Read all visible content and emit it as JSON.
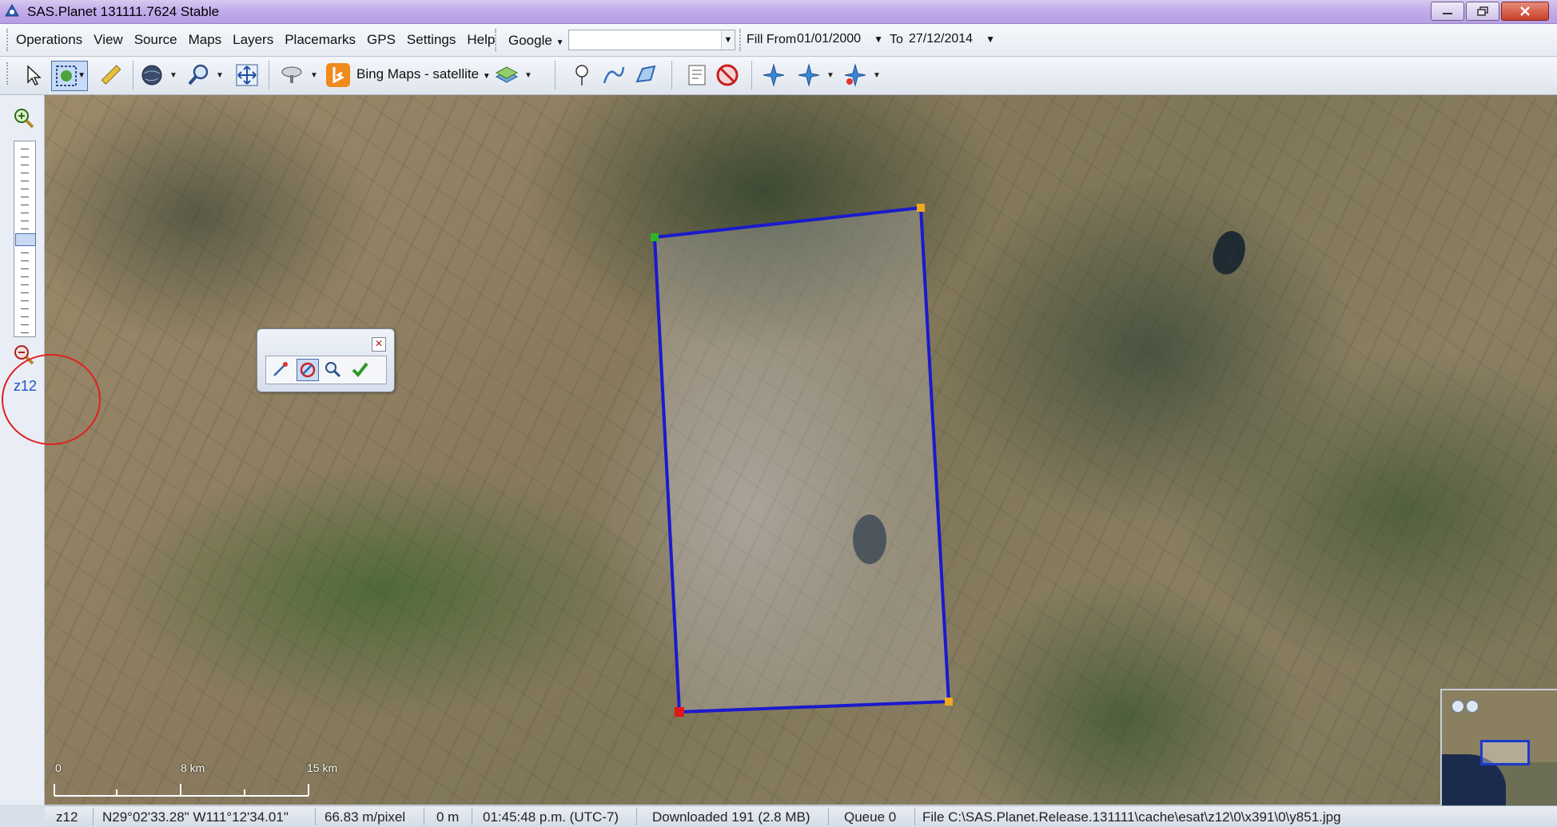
{
  "window": {
    "title": "SAS.Planet 131111.7624 Stable"
  },
  "menu": {
    "items": [
      "Operations",
      "View",
      "Source",
      "Maps",
      "Layers",
      "Placemarks",
      "GPS",
      "Settings",
      "Help"
    ],
    "google_label": "Google",
    "search_placeholder": ""
  },
  "fill": {
    "from_label": "Fill From",
    "from_date": "01/01/2000",
    "to_label": "To",
    "to_date": "27/12/2014"
  },
  "toolbar": {
    "map_source": "Bing Maps - satellite"
  },
  "left_panel": {
    "zoom_label": "z12"
  },
  "scale_bar": {
    "ticks": [
      "0",
      "8 km",
      "15 km"
    ]
  },
  "status": {
    "zoom": "z12",
    "coordinates": "N29°02'33.28\" W111°12'34.01\"",
    "resolution": "66.83 m/pixel",
    "altitude": "0 m",
    "time": "01:45:48 p.m. (UTC-7)",
    "downloaded": "Downloaded 191 (2.8 MB)",
    "queue": "Queue 0",
    "file": "File C:\\SAS.Planet.Release.131111\\cache\\esat\\z12\\0\\x391\\0\\y851.jpg"
  },
  "colors": {
    "selection_line": "#1a1acd",
    "zoom_label": "#1c52c9",
    "highlight_circle": "#e02020"
  }
}
